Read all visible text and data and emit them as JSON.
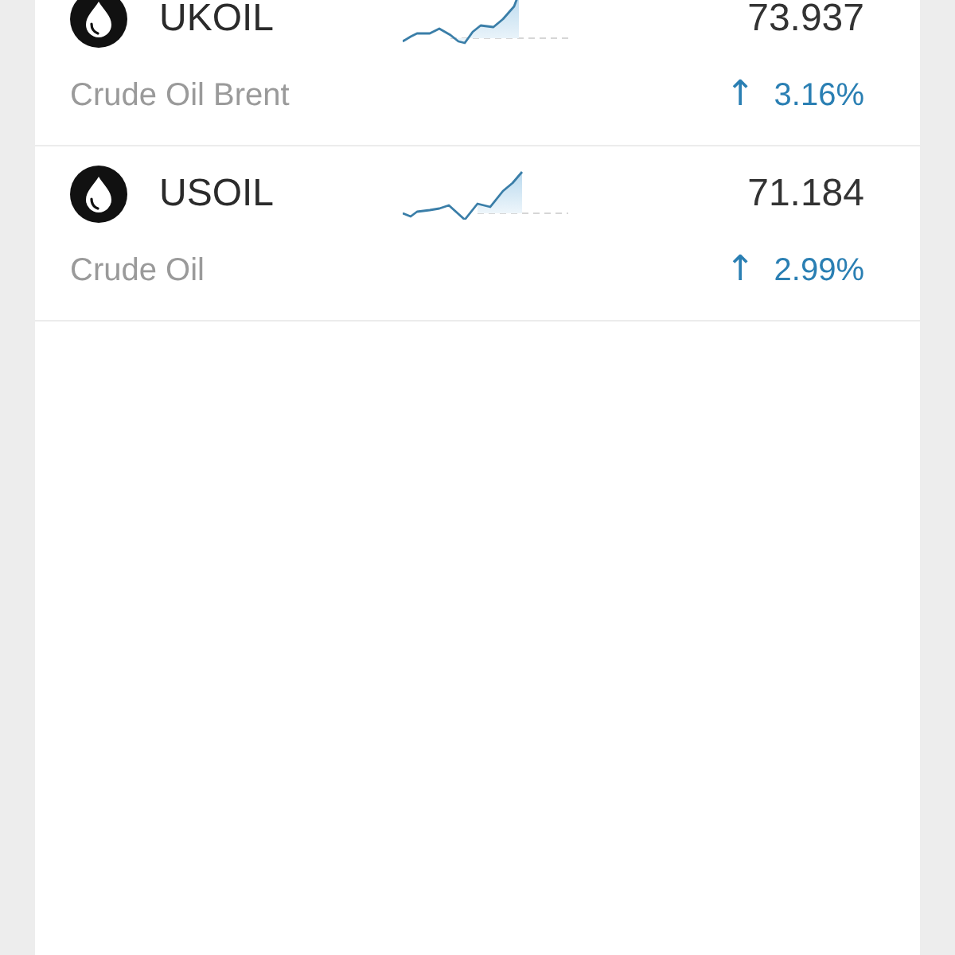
{
  "instruments": [
    {
      "symbol": "UKOIL",
      "name": "Crude Oil Brent",
      "price": "73.937",
      "arrow": "↑",
      "change": "3.16%"
    },
    {
      "symbol": "USOIL",
      "name": "Crude Oil",
      "price": "71.184",
      "arrow": "↑",
      "change": "2.99%"
    }
  ]
}
